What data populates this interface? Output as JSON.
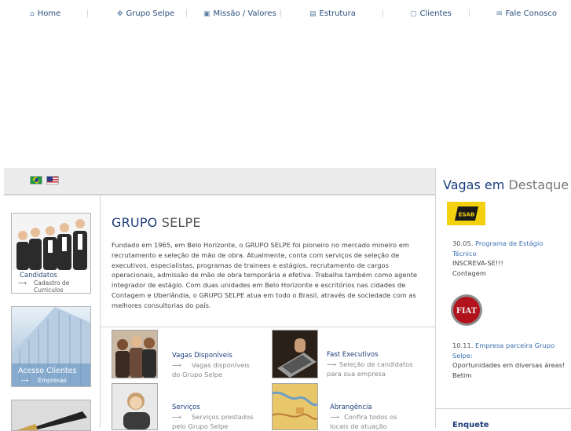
{
  "nav": {
    "home": "Home",
    "grupo": "Grupo Selpe",
    "missao": "Missão / Valores",
    "estrutura": "Estrutura",
    "clientes": "Clientes",
    "fale": "Fale Conosco"
  },
  "left": {
    "candidatos_title": "Candidatos",
    "candidatos_sub": "Cadastro de Curriculos",
    "clientes_title": "Acesso Clientes",
    "clientes_sub": "Empresas",
    "arrow": "⟶"
  },
  "main": {
    "title_a": "GRUPO",
    "title_b": "SELPE",
    "paragraph": "Fundado em 1965, em Belo Horizonte, o GRUPO SELPE foi pioneiro no mercado mineiro em recrutamento e seleção de mão de obra. Atualmente, conta com serviços de seleção de executivos, especialistas, programas de trainees e estágios, recrutamento de cargos operacionais, admissão de mão de obra temporária e efetiva. Trabalha também como agente integrador de estágio. Com duas unidades em Belo Horizonte e escritórios nas cidades de Contagem e Uberlândia, o GRUPO SELPE atua em todo o Brasil, através de sociedade com as melhores consultorias do país.",
    "features": [
      {
        "title": "Vagas Disponíveis",
        "sub": "Vagas disponíveis do Grupo Selpe"
      },
      {
        "title": "Fast Executivos",
        "sub": "Seleção de candidatos para sua empresa"
      },
      {
        "title": "Serviços",
        "sub": "Serviços prestados pelo Grupo Selpe"
      },
      {
        "title": "Abrangência",
        "sub": "Confira todos os locais de atuação"
      }
    ]
  },
  "right": {
    "title_a": "Vagas em",
    "title_b": "Destaque",
    "esab": "ESAB",
    "fiat": "FIAT",
    "items": [
      {
        "date": "30.05.",
        "link": "Programa de Estágio Técnico",
        "line1": "INSCREVA-SE!!!",
        "line2": "Contagem"
      },
      {
        "date": "10.11.",
        "link": "Empresa parceira Grupo Selpe:",
        "line1": "Oportunidades em diversas áreas!",
        "line2": "Betim"
      }
    ],
    "enquete": "Enquete"
  }
}
